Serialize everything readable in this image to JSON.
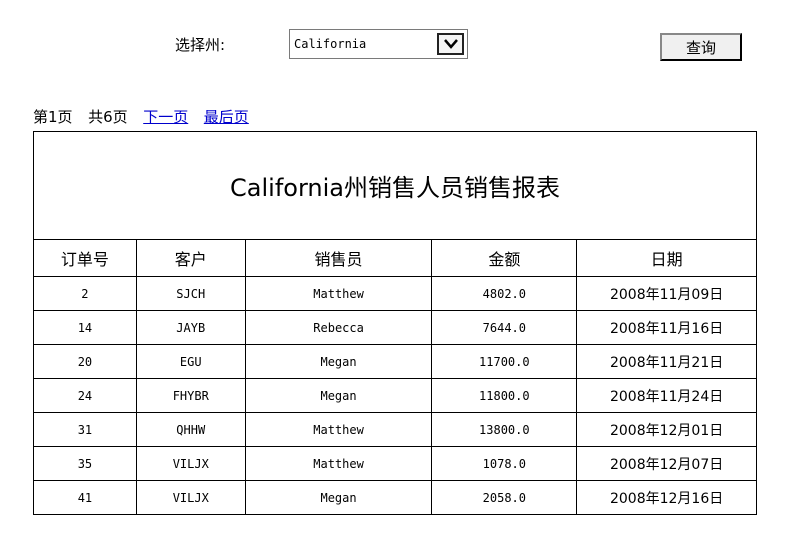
{
  "filter": {
    "label": "选择州:",
    "selected": "California",
    "query_label": "查询"
  },
  "pager": {
    "page_info": "第1页",
    "total_info": "共6页",
    "next": "下一页",
    "last": "最后页"
  },
  "report": {
    "title": "California州销售人员销售报表",
    "headers": [
      "订单号",
      "客户",
      "销售员",
      "金额",
      "日期"
    ],
    "rows": [
      [
        "2",
        "SJCH",
        "Matthew",
        "4802.0",
        "2008年11月09日"
      ],
      [
        "14",
        "JAYB",
        "Rebecca",
        "7644.0",
        "2008年11月16日"
      ],
      [
        "20",
        "EGU",
        "Megan",
        "11700.0",
        "2008年11月21日"
      ],
      [
        "24",
        "FHYBR",
        "Megan",
        "11800.0",
        "2008年11月24日"
      ],
      [
        "31",
        "QHHW",
        "Matthew",
        "13800.0",
        "2008年12月01日"
      ],
      [
        "35",
        "VILJX",
        "Matthew",
        "1078.0",
        "2008年12月07日"
      ],
      [
        "41",
        "VILJX",
        "Megan",
        "2058.0",
        "2008年12月16日"
      ]
    ]
  }
}
